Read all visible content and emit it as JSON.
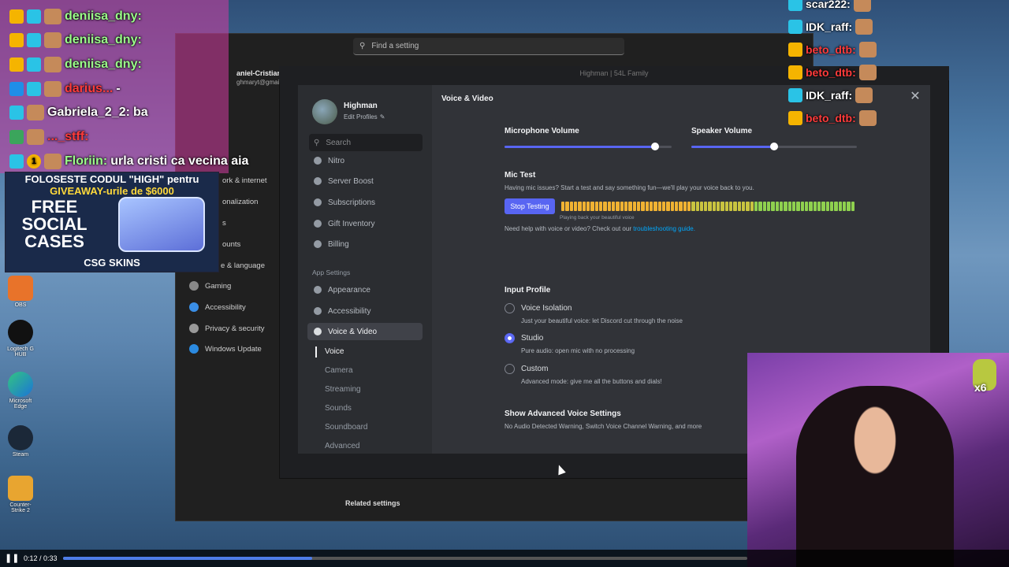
{
  "chat": [
    {
      "badges": [
        "crown",
        "gg"
      ],
      "user": "deniisa_dny:",
      "message": "",
      "user_color": "green"
    },
    {
      "badges": [
        "crown",
        "gg"
      ],
      "user": "deniisa_dny:",
      "message": "",
      "user_color": "green"
    },
    {
      "badges": [
        "crown",
        "gg"
      ],
      "user": "deniisa_dny:",
      "message": "",
      "user_color": "green"
    },
    {
      "badges": [
        "mod",
        "gg"
      ],
      "user": "darius...",
      "message": "-",
      "user_color": "red"
    },
    {
      "badges": [
        "gg"
      ],
      "user": "Gabriela_2_2:",
      "message": "ba",
      "user_color": "white"
    },
    {
      "badges": [
        "sub"
      ],
      "user": "..._stff:",
      "message": "",
      "user_color": "red"
    },
    {
      "badges": [
        "gg",
        "one"
      ],
      "user": "Floriin:",
      "message": "urla cristi ca vecina aia",
      "user_color": "green"
    }
  ],
  "chat_right": [
    {
      "user": "scar222:",
      "user_color": "white"
    },
    {
      "user": "IDK_raff:",
      "user_color": "white"
    },
    {
      "user": "beto_dtb:",
      "user_color": "red"
    },
    {
      "user": "beto_dtb:",
      "user_color": "red"
    },
    {
      "user": "IDK_raff:",
      "user_color": "white"
    },
    {
      "user": "beto_dtb:",
      "user_color": "red"
    }
  ],
  "promo": {
    "headline_line1": "FOLOSESTE CODUL \"HIGH\" pentru",
    "headline_line2": "GIVEAWAY-urile de $6000",
    "big_text": "FREE SOCIAL CASES",
    "brand": "CSG SKINS"
  },
  "windows_settings": {
    "search_placeholder": "Find a setting",
    "user_name": "aniel-Cristian N",
    "user_email": "ghmaryt@gmail.c",
    "nav": [
      "ork & internet",
      "onalization",
      "s",
      "ounts",
      "e & language",
      "Gaming",
      "Accessibility",
      "Privacy & security",
      "Windows Update"
    ],
    "related": "Related settings"
  },
  "discord": {
    "window_title": "Highman | 54L Family",
    "profile_name": "Highman",
    "edit_profiles": "Edit Profiles",
    "search_placeholder": "Search",
    "sidebar_items": [
      "Nitro",
      "Server Boost",
      "Subscriptions",
      "Gift Inventory",
      "Billing"
    ],
    "category_app": "App Settings",
    "app_items": [
      "Appearance",
      "Accessibility",
      "Voice & Video"
    ],
    "active_item": "Voice & Video",
    "sub_items": [
      "Voice",
      "Camera",
      "Streaming",
      "Sounds",
      "Soundboard",
      "Advanced"
    ],
    "content_title": "Voice & Video",
    "mic_volume_label": "Microphone Volume",
    "mic_volume": 0.9,
    "speaker_volume_label": "Speaker Volume",
    "speaker_volume": 0.5,
    "mic_test_title": "Mic Test",
    "mic_test_desc": "Having mic issues? Start a test and say something fun—we'll play your voice back to you.",
    "stop_testing": "Stop Testing",
    "playing_back": "Playing back your beautiful voice",
    "help_text": "Need help with voice or video? Check out our",
    "help_link": "troubleshooting guide.",
    "input_profile_title": "Input Profile",
    "input_profiles": [
      {
        "label": "Voice Isolation",
        "desc": "Just your beautiful voice: let Discord cut through the noise",
        "selected": false
      },
      {
        "label": "Studio",
        "desc": "Pure audio: open mic with no processing",
        "selected": true
      },
      {
        "label": "Custom",
        "desc": "Advanced mode: give me all the buttons and dials!",
        "selected": false
      }
    ],
    "advanced_title": "Show Advanced Voice Settings",
    "advanced_desc": "No Audio Detected Warning, Switch Voice Channel Warning, and more"
  },
  "desktop_icons": [
    "OBS",
    "Logitech G HUB",
    "Microsoft Edge",
    "Steam",
    "Counter-Strike 2"
  ],
  "webcam_emote_count": "x6",
  "player": {
    "time": "0:12 / 0:33",
    "progress": 0.3636
  },
  "colors": {
    "discord_blurple": "#5865f2",
    "chat_green": "#9bff8a",
    "chat_red": "#ff3b3b",
    "meter_yellow": "#f0b232"
  }
}
